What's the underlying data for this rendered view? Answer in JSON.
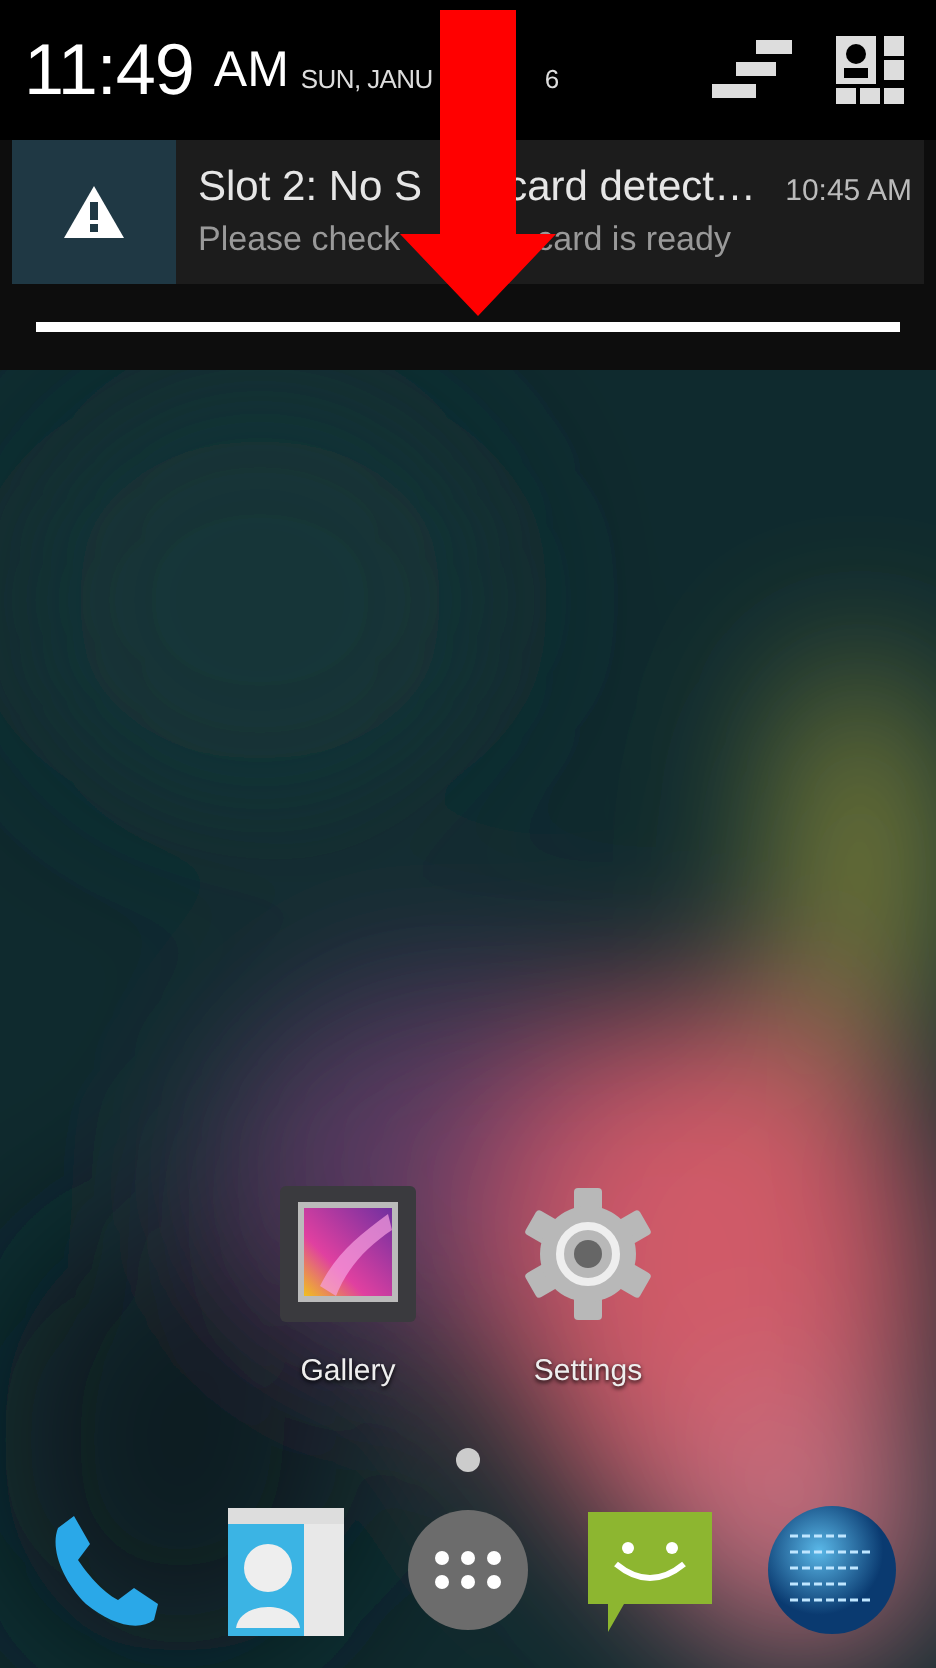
{
  "status_header": {
    "time": "11:49",
    "am_pm": "AM",
    "date_parts": [
      "SUN, JANU",
      "6"
    ]
  },
  "notification": {
    "title_parts": [
      "Slot 2: No S",
      "card detect…"
    ],
    "text_parts": [
      "Please check",
      "card is ready"
    ],
    "time": "10:45 AM"
  },
  "home_apps": [
    {
      "label": "Gallery",
      "kind": "gallery"
    },
    {
      "label": "Settings",
      "kind": "settings"
    }
  ],
  "page_indicator": [
    {
      "selected": true
    }
  ],
  "dock": [
    {
      "kind": "phone"
    },
    {
      "kind": "contacts"
    },
    {
      "kind": "apps"
    },
    {
      "kind": "messaging"
    },
    {
      "kind": "browser"
    }
  ],
  "annotation": {
    "kind": "arrow"
  }
}
